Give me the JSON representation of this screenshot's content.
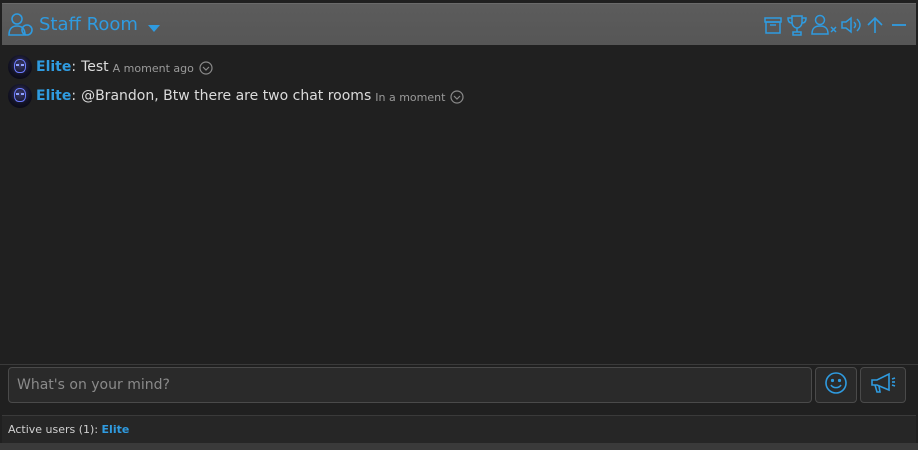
{
  "header": {
    "room_title": "Staff Room",
    "icons": [
      "users-icon",
      "dropdown-caret-icon",
      "archive-icon",
      "trophy-icon",
      "user-remove-icon",
      "sound-icon",
      "scroll-top-icon",
      "minimize-icon"
    ]
  },
  "messages": [
    {
      "user": "Elite",
      "text": "Test",
      "time": "A moment ago"
    },
    {
      "user": "Elite",
      "text": "@Brandon, Btw there are two chat rooms",
      "time": "In a moment"
    }
  ],
  "composer": {
    "placeholder": "What's on your mind?"
  },
  "footer": {
    "active_users_label": "Active users (1):",
    "active_user": "Elite"
  },
  "colors": {
    "accent": "#2f9be0",
    "background": "#202020",
    "header": "#5a5a5a"
  }
}
